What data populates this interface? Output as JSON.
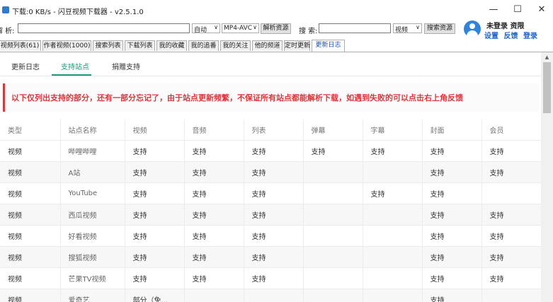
{
  "window": {
    "title": "下载:0 KB/s - 闪豆视频下载器 - v2.5.1.0",
    "minimize": "—",
    "maximize": "☐",
    "close": "✕"
  },
  "toolbar": {
    "parse_label": "解 析:",
    "parse_value": "",
    "quality": "自动",
    "format": "MP4-AVC",
    "parse_button": "解析资源",
    "search_label": "搜 索:",
    "search_value": "",
    "search_type": "视频",
    "search_button": "搜索资源"
  },
  "user": {
    "status": "未登录  资限",
    "links": [
      "设置",
      "反馈",
      "登录"
    ]
  },
  "tabs": [
    "视频列表(61)",
    "作者视频(1000)",
    "搜索列表",
    "下载列表",
    "我的收藏",
    "我的追番",
    "我的关注",
    "他的频道",
    "定时更新",
    "更新日志"
  ],
  "subtabs": [
    "更新日志",
    "支持站点",
    "捐赠支持"
  ],
  "notice": "以下仅列出支持的部分，还有一部分忘记了，由于站点更新频繁，不保证所有站点都能解析下载，如遇到失败的可以点击右上角反馈",
  "table": {
    "headers": [
      "类型",
      "站点名称",
      "视频",
      "音频",
      "列表",
      "弹幕",
      "字幕",
      "封面",
      "会员"
    ],
    "rows": [
      [
        "视频",
        "哔哩哔哩",
        "支持",
        "支持",
        "支持",
        "支持",
        "支持",
        "支持",
        "支持"
      ],
      [
        "视频",
        "A站",
        "支持",
        "支持",
        "支持",
        "",
        "",
        "支持",
        "支持"
      ],
      [
        "视频",
        "YouTube",
        "支持",
        "支持",
        "支持",
        "",
        "支持",
        "支持",
        ""
      ],
      [
        "视频",
        "西瓜视频",
        "支持",
        "支持",
        "支持",
        "",
        "",
        "支持",
        "支持"
      ],
      [
        "视频",
        "好看视频",
        "支持",
        "支持",
        "支持",
        "",
        "",
        "支持",
        "支持"
      ],
      [
        "视频",
        "搜狐视频",
        "支持",
        "支持",
        "支持",
        "",
        "",
        "支持",
        "支持"
      ],
      [
        "视频",
        "芒果TV视频",
        "支持",
        "支持",
        "支持",
        "",
        "",
        "支持",
        "支持"
      ],
      [
        "视频",
        "爱奇艺",
        "部分（免...",
        "",
        "",
        "",
        "",
        "支持",
        ""
      ]
    ]
  },
  "scrollbar": {
    "up_arrow": "▲"
  },
  "colors": {
    "accent": "#1a9a7a",
    "notice": "#e0343a",
    "link": "#1a64c8"
  }
}
